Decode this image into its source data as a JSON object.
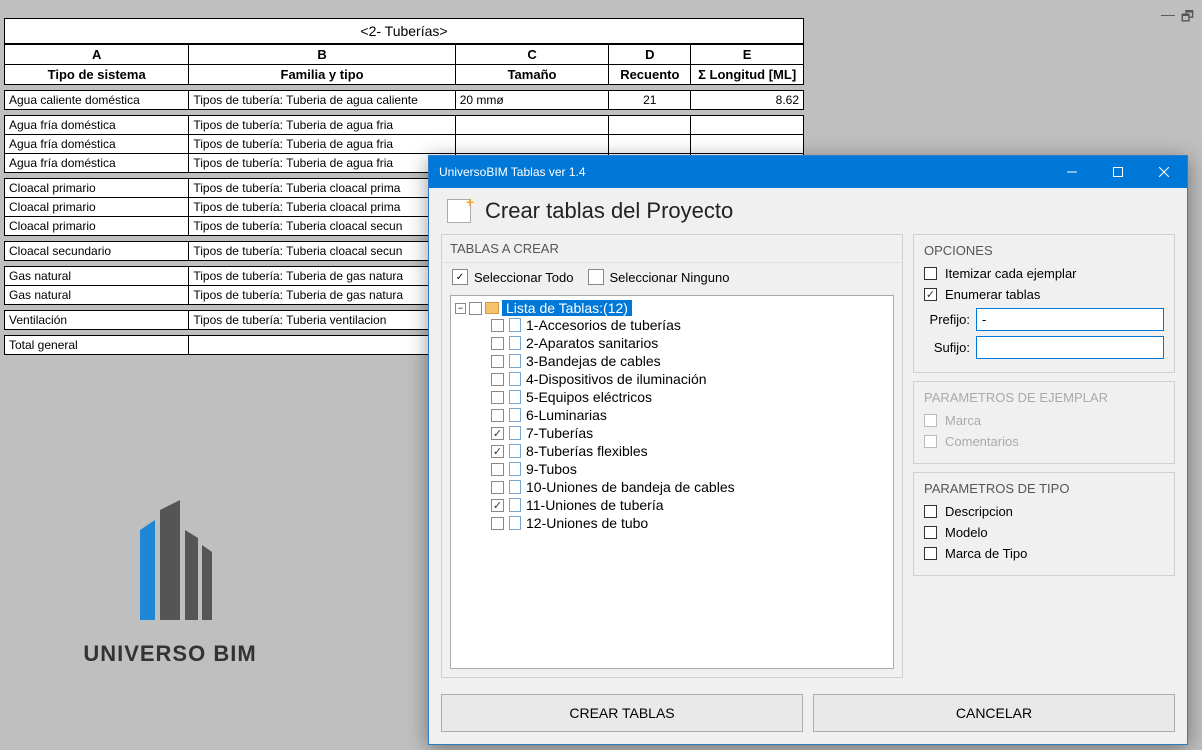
{
  "window": {
    "schedule_title": "<2- Tuberías>",
    "columns": [
      {
        "letter": "A",
        "name": "Tipo de sistema"
      },
      {
        "letter": "B",
        "name": "Familia y tipo"
      },
      {
        "letter": "C",
        "name": "Tamaño"
      },
      {
        "letter": "D",
        "name": "Recuento"
      },
      {
        "letter": "E",
        "name": "Σ Longitud [ML]"
      }
    ],
    "groups": [
      {
        "rows": [
          {
            "a": "Agua caliente doméstica",
            "b": "Tipos de tubería: Tuberia de agua caliente",
            "c": "20 mmø",
            "d": "21",
            "e": "8.62"
          }
        ]
      },
      {
        "rows": [
          {
            "a": "Agua fría doméstica",
            "b": "Tipos de tubería: Tuberia de agua fria",
            "c": "",
            "d": "",
            "e": ""
          },
          {
            "a": "Agua fría doméstica",
            "b": "Tipos de tubería: Tuberia de agua fria",
            "c": "",
            "d": "",
            "e": ""
          },
          {
            "a": "Agua fría doméstica",
            "b": "Tipos de tubería: Tuberia de agua fria",
            "c": "",
            "d": "",
            "e": ""
          }
        ]
      },
      {
        "rows": [
          {
            "a": "Cloacal primario",
            "b": "Tipos de tubería: Tuberia cloacal prima",
            "c": "",
            "d": "",
            "e": ""
          },
          {
            "a": "Cloacal primario",
            "b": "Tipos de tubería: Tuberia cloacal prima",
            "c": "",
            "d": "",
            "e": ""
          },
          {
            "a": "Cloacal primario",
            "b": "Tipos de tubería: Tuberia cloacal secun",
            "c": "",
            "d": "",
            "e": ""
          }
        ]
      },
      {
        "rows": [
          {
            "a": "Cloacal secundario",
            "b": "Tipos de tubería: Tuberia cloacal secun",
            "c": "",
            "d": "",
            "e": ""
          }
        ]
      },
      {
        "rows": [
          {
            "a": "Gas natural",
            "b": "Tipos de tubería: Tuberia de gas natura",
            "c": "",
            "d": "",
            "e": ""
          },
          {
            "a": "Gas natural",
            "b": "Tipos de tubería: Tuberia de gas natura",
            "c": "",
            "d": "",
            "e": ""
          }
        ]
      },
      {
        "rows": [
          {
            "a": "Ventilación",
            "b": "Tipos de tubería: Tuberia ventilacion",
            "c": "",
            "d": "",
            "e": ""
          }
        ]
      },
      {
        "rows": [
          {
            "a": "Total general",
            "b": "",
            "c": "",
            "d": "",
            "e": ""
          }
        ]
      }
    ]
  },
  "logo_text": "UNIVERSO BIM",
  "dialog": {
    "title": "UniversoBIM Tablas ver 1.4",
    "heading": "Crear tablas del Proyecto",
    "tables_label": "TABLAS A CREAR",
    "select_all": "Seleccionar Todo",
    "select_none": "Seleccionar Ninguno",
    "tree_root": "Lista de Tablas:(12)",
    "tree_items": [
      {
        "label": "1-Accesorios de tuberías",
        "checked": false
      },
      {
        "label": "2-Aparatos sanitarios",
        "checked": false
      },
      {
        "label": "3-Bandejas de cables",
        "checked": false
      },
      {
        "label": "4-Dispositivos de iluminación",
        "checked": false
      },
      {
        "label": "5-Equipos eléctricos",
        "checked": false
      },
      {
        "label": "6-Luminarias",
        "checked": false
      },
      {
        "label": "7-Tuberías",
        "checked": true
      },
      {
        "label": "8-Tuberías flexibles",
        "checked": true
      },
      {
        "label": "9-Tubos",
        "checked": false
      },
      {
        "label": "10-Uniones de bandeja de cables",
        "checked": false
      },
      {
        "label": "11-Uniones de tubería",
        "checked": true
      },
      {
        "label": "12-Uniones de tubo",
        "checked": false
      }
    ],
    "options": {
      "title": "OPCIONES",
      "itemize": {
        "label": "Itemizar cada ejemplar",
        "checked": false
      },
      "enumerate": {
        "label": "Enumerar tablas",
        "checked": true
      },
      "prefix_label": "Prefijo:",
      "prefix_value": "-",
      "suffix_label": "Sufijo:",
      "suffix_value": ""
    },
    "params_instance": {
      "title": "PARAMETROS DE EJEMPLAR",
      "marca": "Marca",
      "comentarios": "Comentarios"
    },
    "params_type": {
      "title": "PARAMETROS DE TIPO",
      "descripcion": {
        "label": "Descripcion",
        "checked": false
      },
      "modelo": {
        "label": "Modelo",
        "checked": false
      },
      "marca_tipo": {
        "label": "Marca de Tipo",
        "checked": false
      }
    },
    "create_btn": "CREAR TABLAS",
    "cancel_btn": "CANCELAR"
  }
}
